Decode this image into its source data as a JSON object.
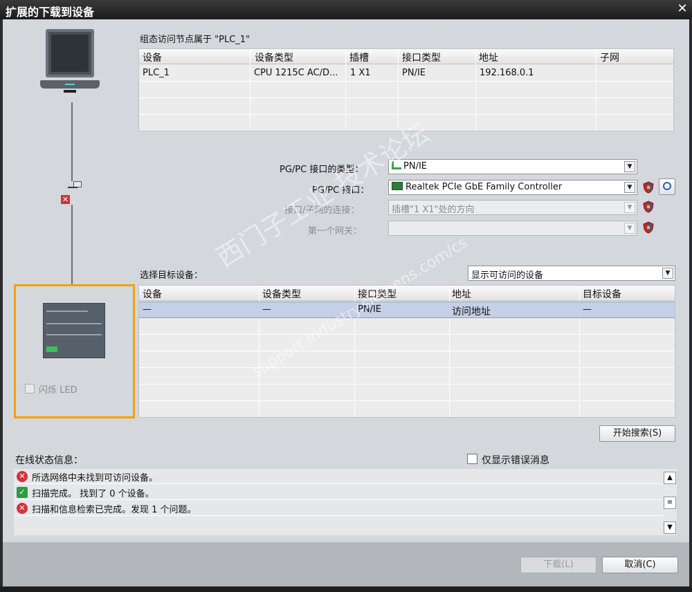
{
  "window": {
    "title": "扩展的下载到设备",
    "close": "✕"
  },
  "config": {
    "caption": "组态访问节点属于 \"PLC_1\"",
    "headers": [
      "设备",
      "设备类型",
      "插槽",
      "接口类型",
      "地址",
      "子网"
    ],
    "rows": [
      [
        "PLC_1",
        "CPU 1215C AC/D...",
        "1 X1",
        "PN/IE",
        "192.168.0.1",
        ""
      ]
    ]
  },
  "pgpc": {
    "type_label": "PG/PC 接口的类型：",
    "type_value": "PN/IE",
    "iface_label": "PG/PC 接口：",
    "iface_value": "Realtek PCIe GbE Family Controller",
    "conn_label": "接口/子网的连接：",
    "conn_value": "插槽\"1 X1\"处的方向",
    "gateway_label": "第一个网关：",
    "gateway_value": ""
  },
  "target": {
    "label": "选择目标设备：",
    "filter_value": "显示可访问的设备",
    "headers": [
      "设备",
      "设备类型",
      "接口类型",
      "地址",
      "目标设备"
    ],
    "rows": [
      [
        "—",
        "—",
        "PN/IE",
        "访问地址",
        "—"
      ]
    ]
  },
  "flash_led": "闪烁 LED",
  "error_marker": "✕",
  "search_button": "开始搜索(S)",
  "status": {
    "label": "在线状态信息：",
    "only_errors": "仅显示错误消息",
    "messages": [
      {
        "type": "error",
        "text": "所选网络中未找到可访问设备。"
      },
      {
        "type": "ok",
        "text": "扫描完成。 找到了 0 个设备。"
      },
      {
        "type": "error",
        "text": "扫描和信息检索已完成。发现 1 个问题。"
      }
    ]
  },
  "buttons": {
    "download": "下载(L)",
    "cancel": "取消(C)"
  },
  "watermark": {
    "line1": "西门子工业  技术论坛",
    "line2": "support.industry.siemens.com/cs"
  },
  "colors": {
    "accent_frame": "#f2a300",
    "selected_row": "#c5cfe6",
    "error": "#d5313b",
    "ok": "#2a9d3e"
  }
}
